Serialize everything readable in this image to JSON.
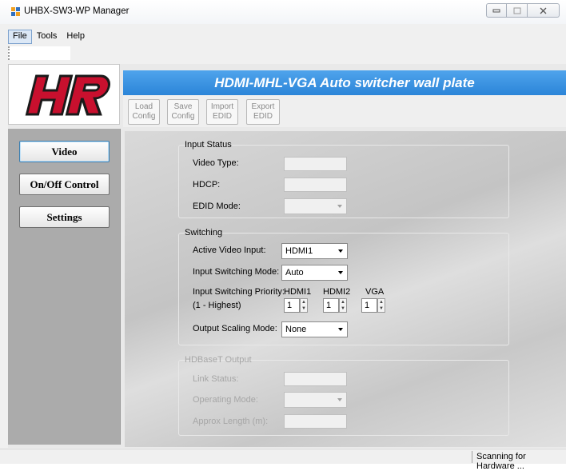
{
  "window": {
    "title": "UHBX-SW3-WP Manager"
  },
  "menu": {
    "items": [
      "File",
      "Tools",
      "Help"
    ]
  },
  "header": {
    "title": "HDMI-MHL-VGA Auto switcher wall plate"
  },
  "toolbar": {
    "load_label": [
      "Load",
      "Config"
    ],
    "save_label": [
      "Save",
      "Config"
    ],
    "import_label": [
      "Import",
      "EDID"
    ],
    "export_label": [
      "Export",
      "EDID"
    ]
  },
  "logo_text": "HR",
  "nav": {
    "items": [
      "Video",
      "On/Off Control",
      "Settings"
    ],
    "selected": "Video"
  },
  "input_status": {
    "title": "Input Status",
    "video_type_label": "Video Type:",
    "hdcp_label": "HDCP:",
    "edid_mode_label": "EDID Mode:"
  },
  "switching": {
    "title": "Switching",
    "active_input_label": "Active Video Input:",
    "active_input_value": "HDMI1",
    "mode_label": "Input Switching Mode:",
    "mode_value": "Auto",
    "priority_label": "Input Switching Priority:",
    "priority_sub": "(1 - Highest)",
    "priority_columns": [
      "HDMI1",
      "HDMI2",
      "VGA"
    ],
    "priority_values": [
      "1",
      "1",
      "1"
    ],
    "scaling_label": "Output Scaling Mode:",
    "scaling_value": "None"
  },
  "hdbaset": {
    "title": "HDBaseT Output",
    "link_status_label": "Link Status:",
    "operating_mode_label": "Operating Mode:",
    "approx_length_label": "Approx Length (m):"
  },
  "status": {
    "text": "Scanning for Hardware ..."
  },
  "colors": {
    "header_blue": "#2b85d8",
    "logo_red": "#c8102e"
  }
}
